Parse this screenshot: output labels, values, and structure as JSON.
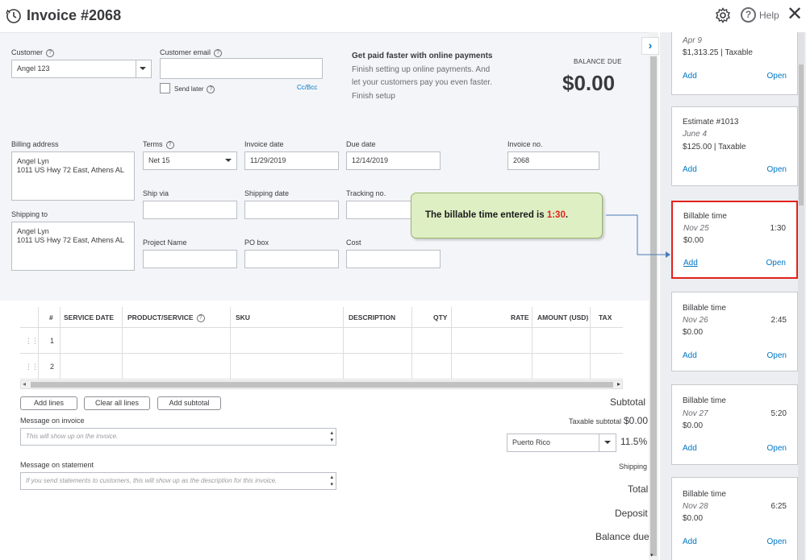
{
  "window": {
    "title": "Invoice #2068",
    "help_label": "Help"
  },
  "customer": {
    "label": "Customer",
    "value": "Angel 123"
  },
  "customer_email": {
    "label": "Customer email",
    "value": "",
    "send_later_label": "Send later",
    "send_later_checked": false,
    "cc_bcc_label": "Cc/Bcc"
  },
  "promo": {
    "title": "Get paid faster with online payments",
    "lines": [
      "Finish setting up online payments. And",
      "let your customers pay you even faster."
    ],
    "link": "Finish setup"
  },
  "balance_due": {
    "label": "BALANCE DUE",
    "value": "$0.00"
  },
  "billing_address": {
    "label": "Billing address",
    "line1": "Angel Lyn",
    "line2": "1011 US Hwy 72 East, Athens AL"
  },
  "shipping_to": {
    "label": "Shipping to",
    "line1": "Angel Lyn",
    "line2": "1011 US Hwy 72 East, Athens AL"
  },
  "terms": {
    "label": "Terms",
    "value": "Net 15"
  },
  "invoice_date": {
    "label": "Invoice date",
    "value": "11/29/2019"
  },
  "due_date": {
    "label": "Due date",
    "value": "12/14/2019"
  },
  "invoice_no": {
    "label": "Invoice no.",
    "value": "2068"
  },
  "ship_via": {
    "label": "Ship via",
    "value": ""
  },
  "shipping_date": {
    "label": "Shipping date",
    "value": ""
  },
  "tracking_no": {
    "label": "Tracking no.",
    "value": ""
  },
  "project_name": {
    "label": "Project Name",
    "value": ""
  },
  "po_box": {
    "label": "PO box",
    "value": ""
  },
  "cost": {
    "label": "Cost",
    "value": ""
  },
  "table": {
    "headers": {
      "num": "#",
      "service_date": "SERVICE DATE",
      "product": "PRODUCT/SERVICE",
      "sku": "SKU",
      "description": "DESCRIPTION",
      "qty": "QTY",
      "rate": "RATE",
      "amount": "AMOUNT (USD)",
      "tax": "TAX"
    },
    "rows": [
      {
        "num": "1"
      },
      {
        "num": "2"
      }
    ]
  },
  "buttons": {
    "add_lines": "Add lines",
    "clear_all_lines": "Clear all lines",
    "add_subtotal": "Add subtotal"
  },
  "message_invoice": {
    "label": "Message on invoice",
    "placeholder": "This will show up on the invoice."
  },
  "message_statement": {
    "label": "Message on statement",
    "placeholder": "If you send statements to customers, this will show up as the description for this invoice."
  },
  "summary": {
    "subtotal_label": "Subtotal",
    "taxable_subtotal_label": "Taxable subtotal",
    "taxable_subtotal_value": "$0.00",
    "tax_region": "Puerto Rico",
    "tax_rate": "11.5%",
    "shipping_label": "Shipping",
    "total_label": "Total",
    "deposit_label": "Deposit",
    "balance_due_label": "Balance due"
  },
  "drawer": {
    "cards": [
      {
        "title": "",
        "date": "Apr 9",
        "duration": "",
        "amount": "$1,313.25 | Taxable",
        "add": "Add",
        "open": "Open"
      },
      {
        "title": "Estimate #1013",
        "date": "June 4",
        "duration": "",
        "amount": "$125.00 | Taxable",
        "add": "Add",
        "open": "Open"
      },
      {
        "title": "Billable time",
        "date": "Nov 25",
        "duration": "1:30",
        "amount": "$0.00",
        "add": "Add",
        "open": "Open"
      },
      {
        "title": "Billable time",
        "date": "Nov 26",
        "duration": "2:45",
        "amount": "$0.00",
        "add": "Add",
        "open": "Open"
      },
      {
        "title": "Billable time",
        "date": "Nov 27",
        "duration": "5:20",
        "amount": "$0.00",
        "add": "Add",
        "open": "Open"
      },
      {
        "title": "Billable time",
        "date": "Nov 28",
        "duration": "6:25",
        "amount": "$0.00",
        "add": "Add",
        "open": "Open"
      }
    ]
  },
  "callout": {
    "text": "The billable time entered is ",
    "highlight": "1:30",
    "suffix": "."
  },
  "colors": {
    "accent": "#0077c5",
    "highlight_border": "#e3211c",
    "callout_bg": "#dfefc4"
  }
}
